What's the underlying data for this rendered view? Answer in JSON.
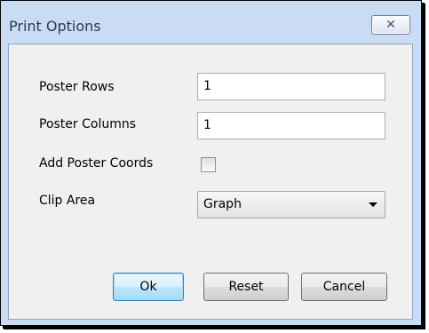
{
  "window": {
    "title": "Print Options",
    "close_glyph": "✕",
    "close_icon": "close-icon"
  },
  "form": {
    "poster_rows": {
      "label": "Poster Rows",
      "value": "1"
    },
    "poster_columns": {
      "label": "Poster Columns",
      "value": "1"
    },
    "add_poster_coords": {
      "label": "Add Poster Coords",
      "checked": false
    },
    "clip_area": {
      "label": "Clip Area",
      "selected": "Graph"
    }
  },
  "buttons": {
    "ok": "Ok",
    "reset": "Reset",
    "cancel": "Cancel"
  }
}
